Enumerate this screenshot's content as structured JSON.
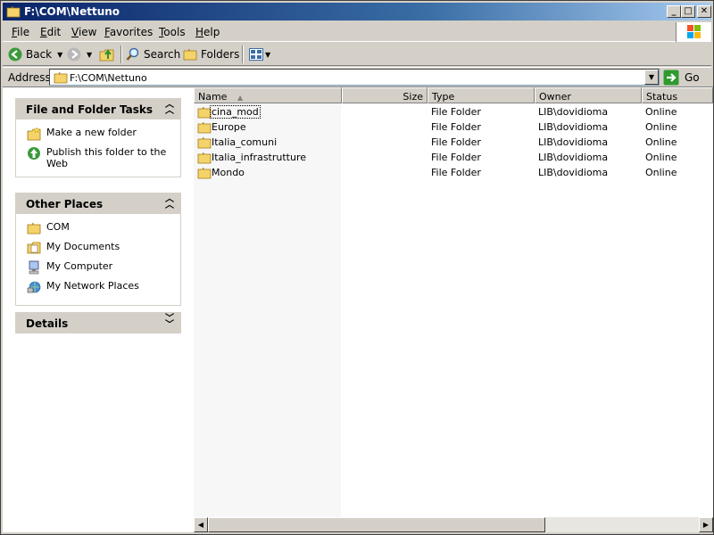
{
  "window": {
    "title": "F:\\COM\\Nettuno",
    "controls": {
      "minimize": "_",
      "maximize": "□",
      "close": "✕"
    }
  },
  "menu": [
    "File",
    "Edit",
    "View",
    "Favorites",
    "Tools",
    "Help"
  ],
  "toolbar": {
    "back_label": "Back",
    "search_label": "Search",
    "folders_label": "Folders"
  },
  "address": {
    "label": "Address",
    "value": "F:\\COM\\Nettuno",
    "go_label": "Go"
  },
  "taskpane": {
    "file_tasks": {
      "title": "File and Folder Tasks",
      "items": [
        {
          "label": "Make a new folder",
          "icon": "new-folder-icon"
        },
        {
          "label": "Publish this folder to the Web",
          "icon": "publish-web-icon"
        }
      ]
    },
    "other_places": {
      "title": "Other Places",
      "items": [
        {
          "label": "COM",
          "icon": "folder-icon"
        },
        {
          "label": "My Documents",
          "icon": "my-documents-icon"
        },
        {
          "label": "My Computer",
          "icon": "my-computer-icon"
        },
        {
          "label": "My Network Places",
          "icon": "network-places-icon"
        }
      ]
    },
    "details": {
      "title": "Details"
    }
  },
  "list": {
    "columns": [
      "Name",
      "Size",
      "Type",
      "Owner",
      "Status"
    ],
    "rows": [
      {
        "name": "cina_mod",
        "type": "File Folder",
        "owner": "LIB\\dovidioma",
        "status": "Online"
      },
      {
        "name": "Europe",
        "type": "File Folder",
        "owner": "LIB\\dovidioma",
        "status": "Online"
      },
      {
        "name": "Italia_comuni",
        "type": "File Folder",
        "owner": "LIB\\dovidioma",
        "status": "Online"
      },
      {
        "name": "Italia_infrastrutture",
        "type": "File Folder",
        "owner": "LIB\\dovidioma",
        "status": "Online"
      },
      {
        "name": "Mondo",
        "type": "File Folder",
        "owner": "LIB\\dovidioma",
        "status": "Online"
      }
    ]
  },
  "colors": {
    "title_bar": "#0a246a",
    "folder": "#f5d36b",
    "panel_header": "#d4d0c8"
  }
}
